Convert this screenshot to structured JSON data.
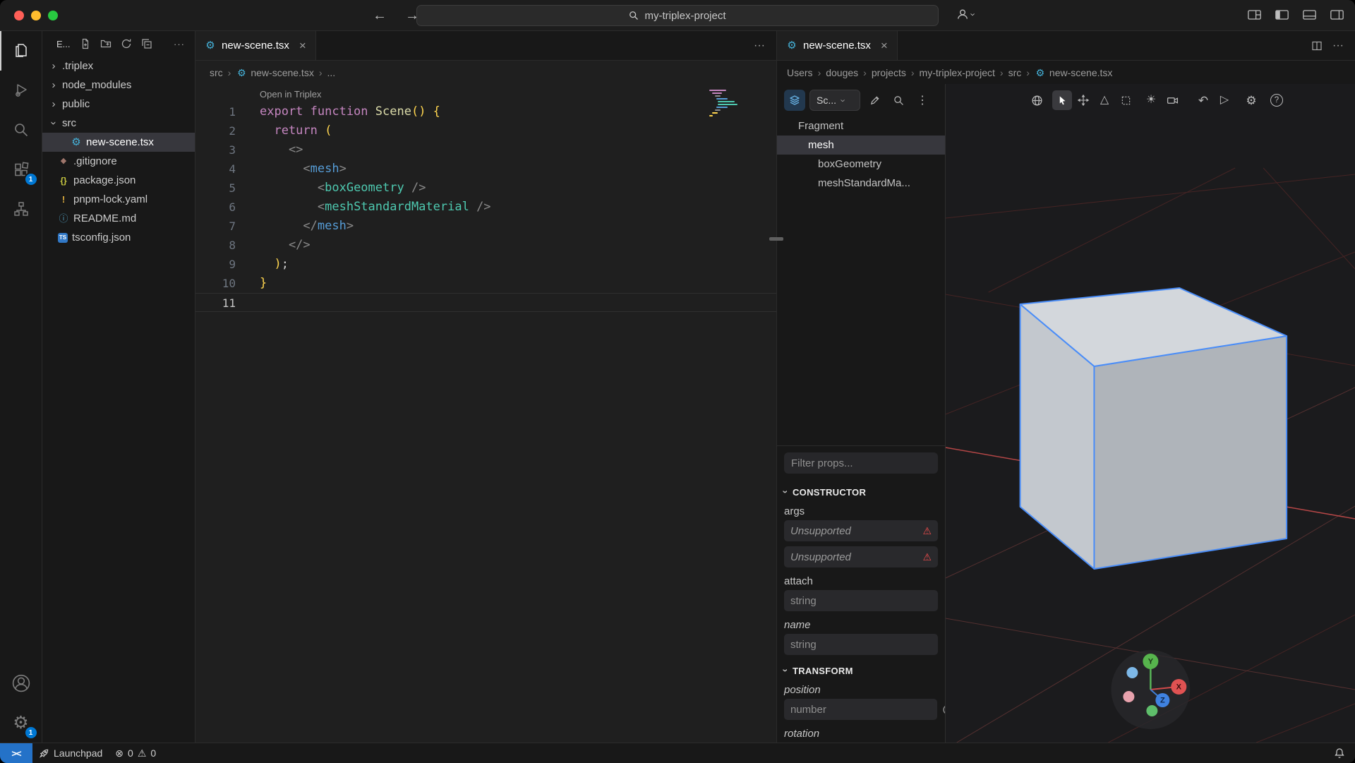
{
  "icons": {
    "back": "←",
    "forward": "→",
    "close": "×",
    "ellipsis": "···",
    "kebab": "⋮",
    "chevron": "›",
    "gear": "⚙",
    "warning": "⚠",
    "error": "⊗",
    "sun": "☀",
    "triangle": "△",
    "undo": "↶",
    "play": "▷",
    "help": "?",
    "remote": "><",
    "info": "ⓘ",
    "braces": "{}",
    "bang": "!",
    "diamond": "◆",
    "ts": "TS"
  },
  "titlebar": {
    "search": "my-triplex-project"
  },
  "activity": {
    "extensions_badge": "1",
    "settings_badge": "1"
  },
  "sidebar": {
    "title": "E...",
    "files": [
      {
        "name": ".triplex"
      },
      {
        "name": "node_modules"
      },
      {
        "name": "public"
      },
      {
        "name": "src"
      },
      {
        "name": "new-scene.tsx"
      },
      {
        "name": ".gitignore"
      },
      {
        "name": "package.json"
      },
      {
        "name": "pnpm-lock.yaml"
      },
      {
        "name": "README.md"
      },
      {
        "name": "tsconfig.json"
      }
    ]
  },
  "editor": {
    "tab": "new-scene.tsx",
    "breadcrumb": [
      "src",
      "new-scene.tsx",
      "..."
    ],
    "codelens": "Open in Triplex",
    "line_numbers": [
      "1",
      "2",
      "3",
      "4",
      "5",
      "6",
      "7",
      "8",
      "9",
      "10",
      "11"
    ],
    "lines": [
      [
        {
          "t": "export function ",
          "c": "kw"
        },
        {
          "t": "Scene",
          "c": "fn"
        },
        {
          "t": "() {",
          "c": "br"
        }
      ],
      [
        {
          "t": "  return",
          "c": "kw"
        },
        {
          "t": " (",
          "c": "br"
        }
      ],
      [
        {
          "t": "    <>",
          "c": "pn"
        }
      ],
      [
        {
          "t": "      <",
          "c": "pn"
        },
        {
          "t": "mesh",
          "c": "tag"
        },
        {
          "t": ">",
          "c": "pn"
        }
      ],
      [
        {
          "t": "        <",
          "c": "pn"
        },
        {
          "t": "boxGeometry",
          "c": "cmp"
        },
        {
          "t": " />",
          "c": "pn"
        }
      ],
      [
        {
          "t": "        <",
          "c": "pn"
        },
        {
          "t": "meshStandardMaterial",
          "c": "cmp"
        },
        {
          "t": " />",
          "c": "pn"
        }
      ],
      [
        {
          "t": "      </",
          "c": "pn"
        },
        {
          "t": "mesh",
          "c": "tag"
        },
        {
          "t": ">",
          "c": "pn"
        }
      ],
      [
        {
          "t": "    </>",
          "c": "pn"
        }
      ],
      [
        {
          "t": "  )",
          "c": "br"
        },
        {
          "t": ";",
          "c": "tx"
        }
      ],
      [
        {
          "t": "}",
          "c": "br"
        }
      ],
      []
    ]
  },
  "rightpanel": {
    "tab": "new-scene.tsx",
    "breadcrumb": [
      "Users",
      "douges",
      "projects",
      "my-triplex-project",
      "src",
      "new-scene.tsx"
    ],
    "toolbar": {
      "scene": "Sc..."
    },
    "tree": [
      "Fragment",
      "mesh",
      "boxGeometry",
      "meshStandardMa..."
    ],
    "filter_placeholder": "Filter props...",
    "constructor": {
      "title": "CONSTRUCTOR",
      "args": "args",
      "unsupported": "Unsupported",
      "attach": "attach",
      "string": "string",
      "name": "name"
    },
    "transform": {
      "title": "TRANSFORM",
      "position": "position",
      "number": "number",
      "rotation": "rotation"
    }
  },
  "gizmo": {
    "x": "X",
    "y": "Y",
    "z": "Z"
  },
  "statusbar": {
    "launchpad": "Launchpad",
    "errors": "0",
    "warnings": "0"
  }
}
